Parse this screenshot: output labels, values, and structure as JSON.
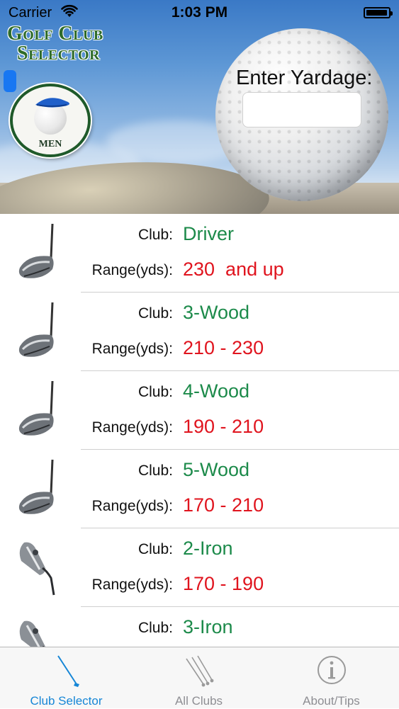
{
  "status_bar": {
    "carrier": "Carrier",
    "time": "1:03 PM",
    "battery_level": 0.95
  },
  "header": {
    "logo_line1": "Golf Club",
    "logo_line2": "Selector",
    "gender_badge": "MEN",
    "yardage_label": "Enter Yardage:",
    "yardage_value": "",
    "yardage_placeholder": ""
  },
  "list": {
    "club_label": "Club:",
    "range_label": "Range(yds):",
    "items": [
      {
        "club": "Driver",
        "range": "230  and up",
        "icon": "wood-club-icon"
      },
      {
        "club": "3-Wood",
        "range": "210 - 230",
        "icon": "wood-club-icon"
      },
      {
        "club": "4-Wood",
        "range": "190 - 210",
        "icon": "wood-club-icon"
      },
      {
        "club": "5-Wood",
        "range": "170 - 210",
        "icon": "wood-club-icon"
      },
      {
        "club": "2-Iron",
        "range": "170 - 190",
        "icon": "iron-club-icon"
      },
      {
        "club": "3-Iron",
        "range": "",
        "icon": "iron-club-icon"
      }
    ]
  },
  "tabs": [
    {
      "label": "Club Selector",
      "icon": "single-club-icon",
      "active": true
    },
    {
      "label": "All Clubs",
      "icon": "club-set-icon",
      "active": false
    },
    {
      "label": "About/Tips",
      "icon": "info-icon",
      "active": false
    }
  ],
  "colors": {
    "club_name": "#1c8a4a",
    "range_value": "#e0141e",
    "tab_active": "#1686d6",
    "tab_inactive": "#8e8e93"
  }
}
